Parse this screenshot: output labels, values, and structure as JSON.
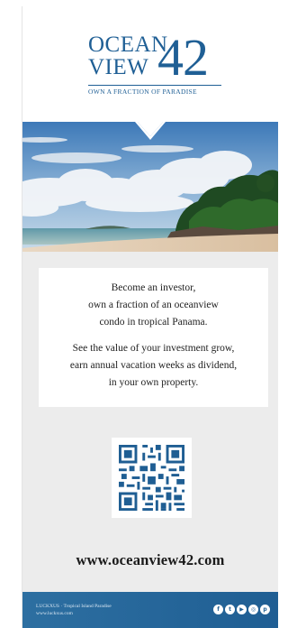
{
  "logo": {
    "ocean": "OCEAN",
    "view": "VIEW",
    "number": "42",
    "tagline": "OWN A FRACTION OF PARADISE"
  },
  "card": {
    "lines1": [
      "Become an investor,",
      "own a fraction of an oceanview",
      "condo in tropical Panama."
    ],
    "lines2": [
      "See the value of your investment grow,",
      "earn annual vacation weeks as dividend,",
      "in your own property."
    ]
  },
  "url": "www.oceanview42.com",
  "footer": {
    "line1": "LUCKXUS · Tropical Island Paradise",
    "line2": "www.luckxus.com",
    "social_icons": [
      "facebook-icon",
      "twitter-icon",
      "youtube-icon",
      "instagram-icon",
      "pinterest-icon"
    ]
  },
  "colors": {
    "brand_blue": "#1f5f95",
    "background": "#ececec",
    "footer_blue": "#2d6fa1"
  }
}
